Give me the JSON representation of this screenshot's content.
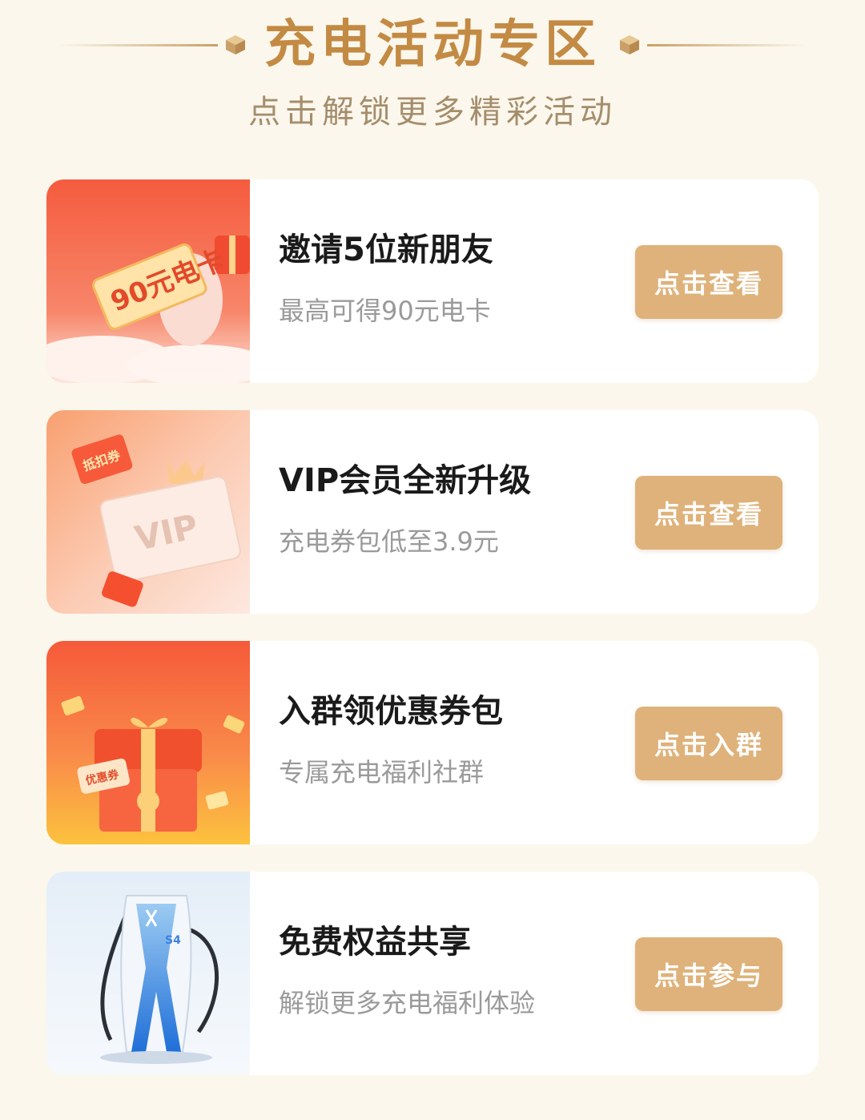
{
  "header": {
    "title": "充电活动专区",
    "subtitle": "点击解锁更多精彩活动"
  },
  "colors": {
    "background": "#fbf7ec",
    "title": "#c38a44",
    "button": "#deb27a"
  },
  "cards": [
    {
      "title": "邀请5位新朋友",
      "desc": "最高可得90元电卡",
      "button": "点击查看",
      "image": {
        "icon": "gift-card-icon",
        "card_text": "90元电卡"
      }
    },
    {
      "title": "VIP会员全新升级",
      "desc": "充电券包低至3.9元",
      "button": "点击查看",
      "image": {
        "icon": "vip-card-icon",
        "tag_text": "抵扣券",
        "card_text": "VIP"
      }
    },
    {
      "title": "入群领优惠券包",
      "desc": "专属充电福利社群",
      "button": "点击入群",
      "image": {
        "icon": "gift-box-icon",
        "tag_text": "优惠券"
      }
    },
    {
      "title": "免费权益共享",
      "desc": "解锁更多充电福利体验",
      "button": "点击参与",
      "image": {
        "icon": "charging-station-icon",
        "label": "S4"
      }
    }
  ]
}
